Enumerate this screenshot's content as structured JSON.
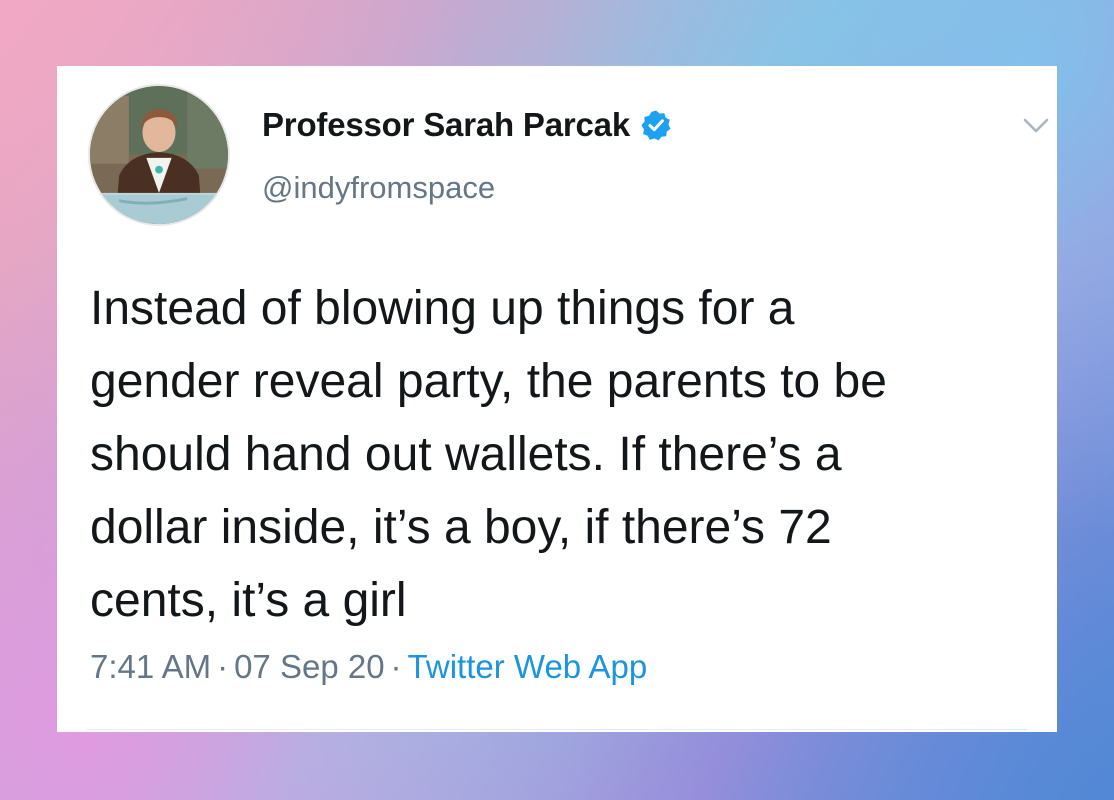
{
  "tweet": {
    "author": {
      "display_name": "Professor Sarah Parcak",
      "handle": "@indyfromspace",
      "verified_icon": "verified-badge-icon",
      "avatar": "avatar-photo"
    },
    "menu_icon": "chevron-down-icon",
    "text_lines": [
      "Instead of blowing up things for a",
      "gender reveal party, the parents to be",
      "should hand out wallets. If there’s a",
      "dollar inside, it’s a boy, if there’s 72",
      "cents, it’s a girl"
    ],
    "time": "7:41 AM",
    "separator": "·",
    "date": "07 Sep 20",
    "source": "Twitter Web App"
  },
  "colors": {
    "text_primary": "#14171a",
    "text_secondary": "#657786",
    "link_blue": "#1b95e0",
    "verified_blue": "#1da1f2",
    "card_background": "#ffffff"
  }
}
